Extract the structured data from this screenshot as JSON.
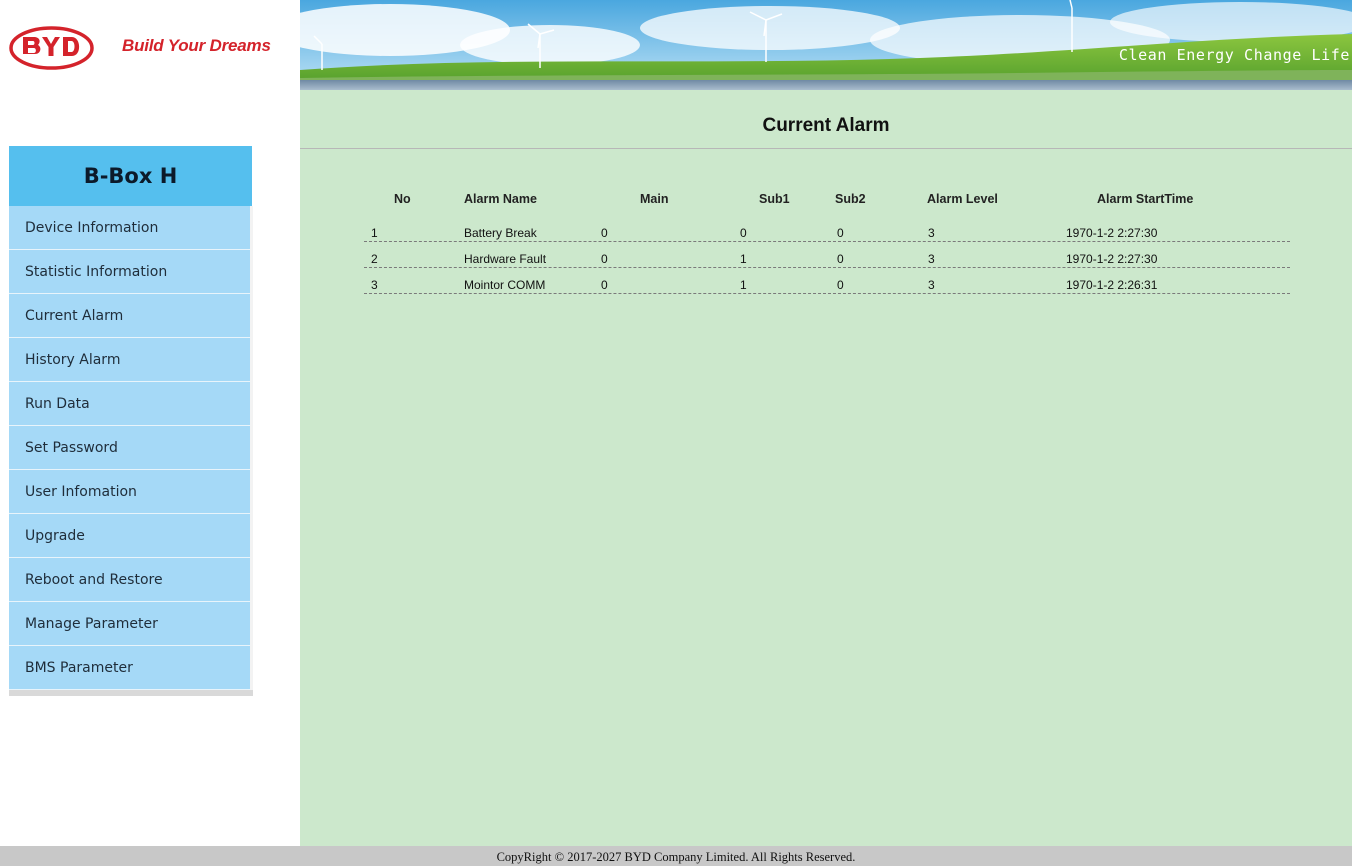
{
  "header": {
    "brand_slogan": "Build Your Dreams",
    "banner_text": "Clean Energy Change Life"
  },
  "sidebar": {
    "title": "B-Box H",
    "items": [
      {
        "label": "Device Information"
      },
      {
        "label": "Statistic Information"
      },
      {
        "label": "Current Alarm"
      },
      {
        "label": "History Alarm"
      },
      {
        "label": "Run Data"
      },
      {
        "label": "Set Password"
      },
      {
        "label": "User Infomation"
      },
      {
        "label": "Upgrade"
      },
      {
        "label": "Reboot and Restore"
      },
      {
        "label": "Manage Parameter"
      },
      {
        "label": "BMS Parameter"
      }
    ]
  },
  "main": {
    "title": "Current Alarm",
    "table": {
      "headers": [
        "No",
        "Alarm Name",
        "Main",
        "Sub1",
        "Sub2",
        "Alarm Level",
        "Alarm StartTime"
      ],
      "rows": [
        [
          "1",
          "Battery Break",
          "0",
          "0",
          "0",
          "3",
          "1970-1-2 2:27:30"
        ],
        [
          "2",
          "Hardware Fault",
          "0",
          "1",
          "0",
          "3",
          "1970-1-2 2:27:30"
        ],
        [
          "3",
          "Mointor COMM",
          "0",
          "1",
          "0",
          "3",
          "1970-1-2 2:26:31"
        ]
      ]
    }
  },
  "footer": {
    "copyright": "CopyRight © 2017-2027 BYD Company Limited. All Rights Reserved."
  },
  "colors": {
    "content_bg": "#cce8cc",
    "sidebar_head": "#55bfee",
    "sidebar_item": "#a5d9f7",
    "brand_red": "#d4232b",
    "footer_bg": "#c8c8c8"
  }
}
